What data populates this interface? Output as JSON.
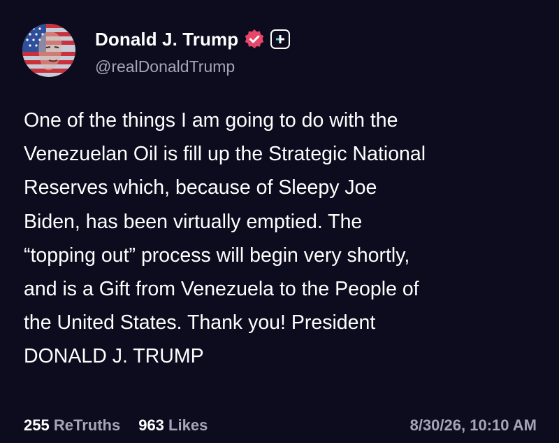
{
  "author": {
    "display_name": "Donald J. Trump",
    "handle": "@realDonaldTrump",
    "avatar_icon": "flag-portrait-avatar",
    "verified_icon": "verified-badge-icon",
    "plus_icon": "plus-badge-icon"
  },
  "post": {
    "text": "One of the things I am going to do with the\nVenezuelan Oil is fill up the Strategic National\nReserves which, because of Sleepy Joe\nBiden, has been virtually emptied. The\n“topping out” process will begin very shortly,\nand is a Gift from Venezuela to the People of\nthe United States. Thank you! President\nDONALD J. TRUMP"
  },
  "footer": {
    "retruths_count": "255",
    "retruths_label": "ReTruths",
    "likes_count": "963",
    "likes_label": "Likes",
    "timestamp": "8/30/26, 10:10 AM"
  },
  "colors": {
    "background": "#0d0b1e",
    "text_primary": "#ffffff",
    "text_secondary": "#a7a4b8",
    "verified_badge": "#e8456b"
  }
}
